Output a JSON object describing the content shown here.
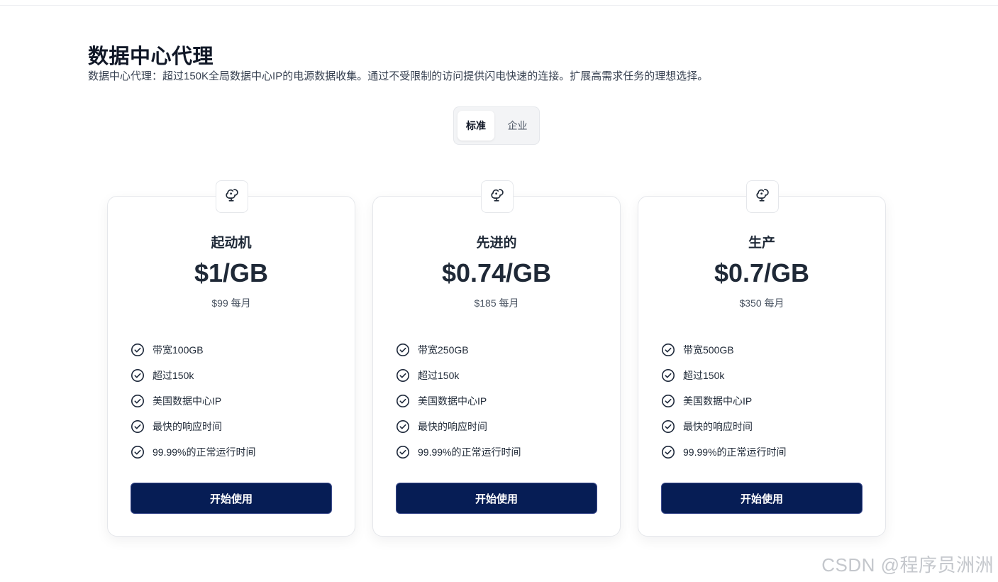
{
  "header": {
    "title": "数据中心代理",
    "subtitle": "数据中心代理：超过150K全局数据中心IP的电源数据收集。通过不受限制的访问提供闪电快速的连接。扩展高需求任务的理想选择。"
  },
  "toggle": {
    "standard_label": "标准",
    "enterprise_label": "企业",
    "selected": "标准"
  },
  "plans": [
    {
      "icon": "squirrel-icon",
      "name": "起动机",
      "price": "$1/GB",
      "monthly": "$99 每月",
      "features": [
        "带宽100GB",
        "超过150k",
        "美国数据中心IP",
        "最快的响应时间",
        "99.99%的正常运行时间"
      ],
      "cta": "开始使用"
    },
    {
      "icon": "squirrel-icon",
      "name": "先进的",
      "price": "$0.74/GB",
      "monthly": "$185 每月",
      "features": [
        "带宽250GB",
        "超过150k",
        "美国数据中心IP",
        "最快的响应时间",
        "99.99%的正常运行时间"
      ],
      "cta": "开始使用"
    },
    {
      "icon": "squirrel-icon",
      "name": "生产",
      "price": "$0.7/GB",
      "monthly": "$350 每月",
      "features": [
        "带宽500GB",
        "超过150k",
        "美国数据中心IP",
        "最快的响应时间",
        "99.99%的正常运行时间"
      ],
      "cta": "开始使用"
    }
  ],
  "watermark": "CSDN @程序员洲洲",
  "colors": {
    "cta_background": "#061d55",
    "check_icon": "#1e293b"
  }
}
